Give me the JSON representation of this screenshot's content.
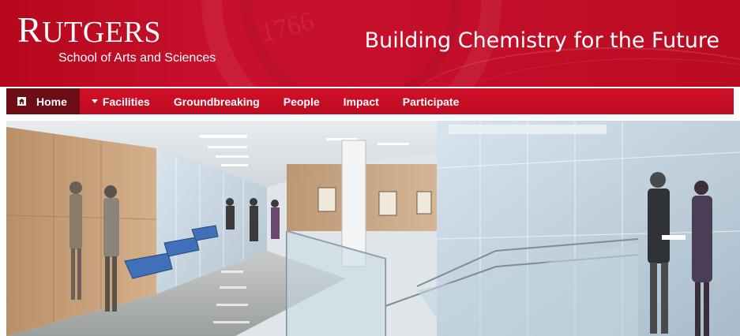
{
  "header": {
    "logo": {
      "first_letter": "R",
      "rest": "UTGERS",
      "subtitle": "School of Arts and Sciences"
    },
    "seal_year": "1766",
    "tagline": "Building Chemistry for the Future",
    "colors": {
      "brand_red": "#c8102e",
      "nav_active": "#6c0d16"
    }
  },
  "nav": {
    "items": [
      {
        "label": "Home",
        "icon": "home-icon",
        "active": true
      },
      {
        "label": "Facilities",
        "icon": "caret-down-icon",
        "active": false
      },
      {
        "label": "Groundbreaking",
        "active": false
      },
      {
        "label": "People",
        "active": false
      },
      {
        "label": "Impact",
        "active": false
      },
      {
        "label": "Participate",
        "active": false
      }
    ]
  },
  "hero": {
    "image": "architectural rendering of a building interior with atrium, stairs and people"
  }
}
